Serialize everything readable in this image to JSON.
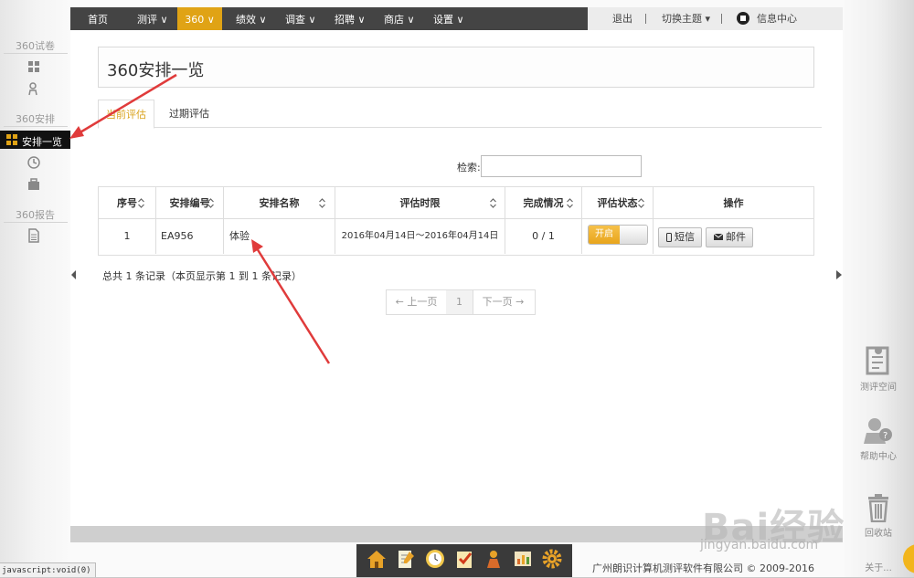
{
  "sidebar": {
    "sections": [
      {
        "title": "360试卷"
      },
      {
        "title": "360安排"
      },
      {
        "title": "360报告"
      }
    ],
    "active_item": "安排一览"
  },
  "topnav": {
    "items": [
      "首页",
      "测评",
      "360",
      "绩效",
      "调查",
      "招聘",
      "商店",
      "设置"
    ],
    "active": "360",
    "logout": "退出",
    "switch_theme": "切换主题",
    "message_center": "信息中心"
  },
  "page": {
    "title": "360安排一览",
    "tabs": [
      "当前评估",
      "过期评估"
    ],
    "search_label": "检索:",
    "search_value": ""
  },
  "table": {
    "headers": [
      "序号",
      "安排编号",
      "安排名称",
      "评估时限",
      "完成情况",
      "评估状态",
      "操作"
    ],
    "rows": [
      {
        "index": "1",
        "code": "EA956",
        "name": "体验",
        "period": "2016年04月14日～2016年04月14日",
        "progress": "0 / 1",
        "status": "开启",
        "sms": "短信",
        "email": "邮件"
      }
    ]
  },
  "info_text": "总共 1 条记录（本页显示第 1 到 1 条记录）",
  "pager": {
    "prev": "← 上一页",
    "page": "1",
    "next": "下一页 →"
  },
  "footer": {
    "copyright": "广州朗识计算机测评软件有限公司 © 2009-2016",
    "status": "javascript:void(0)"
  },
  "right_widgets": [
    "测评空间",
    "帮助中心",
    "回收站",
    "关于..."
  ],
  "watermark": {
    "main": "Bai经验",
    "sub": "jingyan.baidu.com"
  },
  "colors": {
    "accent": "#e0a315",
    "nav_bg": "#444444",
    "arrow": "#e03b3b"
  }
}
